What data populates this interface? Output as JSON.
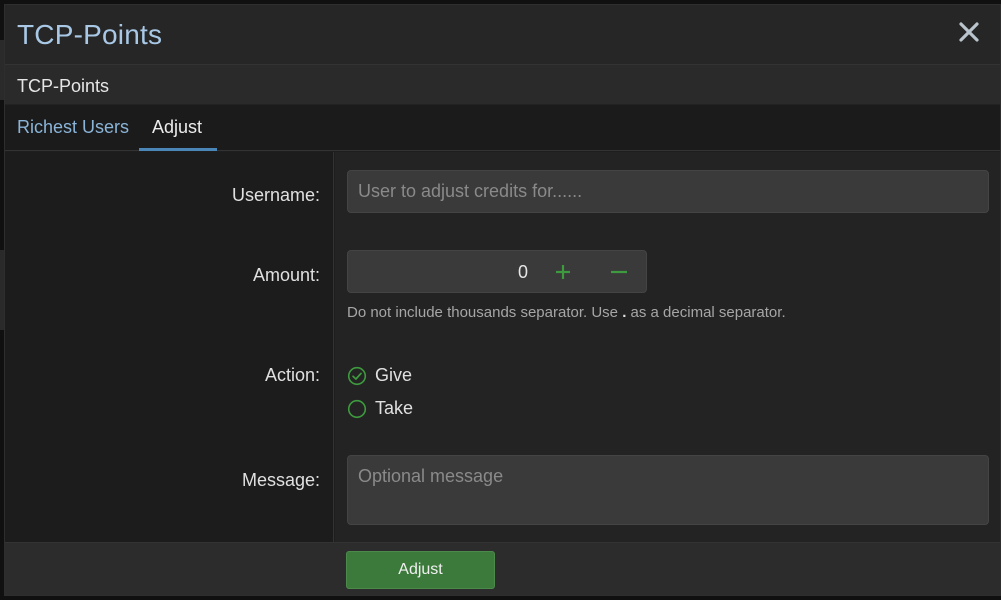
{
  "modal": {
    "title": "TCP-Points",
    "subtitle": "TCP-Points"
  },
  "tabs": [
    {
      "label": "Richest Users",
      "active": false
    },
    {
      "label": "Adjust",
      "active": true
    }
  ],
  "form": {
    "username": {
      "label": "Username:",
      "placeholder": "User to adjust credits for......",
      "value": ""
    },
    "amount": {
      "label": "Amount:",
      "value": "0",
      "hint_before": "Do not include thousands separator. Use",
      "hint_code": ".",
      "hint_after": "as a decimal separator."
    },
    "action": {
      "label": "Action:",
      "options": [
        {
          "label": "Give",
          "selected": true
        },
        {
          "label": "Take",
          "selected": false
        }
      ]
    },
    "message": {
      "label": "Message:",
      "placeholder": "Optional message",
      "value": ""
    }
  },
  "footer": {
    "submit_label": "Adjust"
  },
  "icons": {
    "close": "close-icon",
    "plus": "plus-icon",
    "minus": "minus-icon",
    "radio_checked": "check-circle-icon",
    "radio_unchecked": "circle-icon"
  },
  "colors": {
    "title": "#a8c8e6",
    "link": "#8ab4d8",
    "accent_underline": "#4a86b8",
    "stepper_green": "#3e9a3e",
    "submit_button": "#3c7a3c"
  }
}
